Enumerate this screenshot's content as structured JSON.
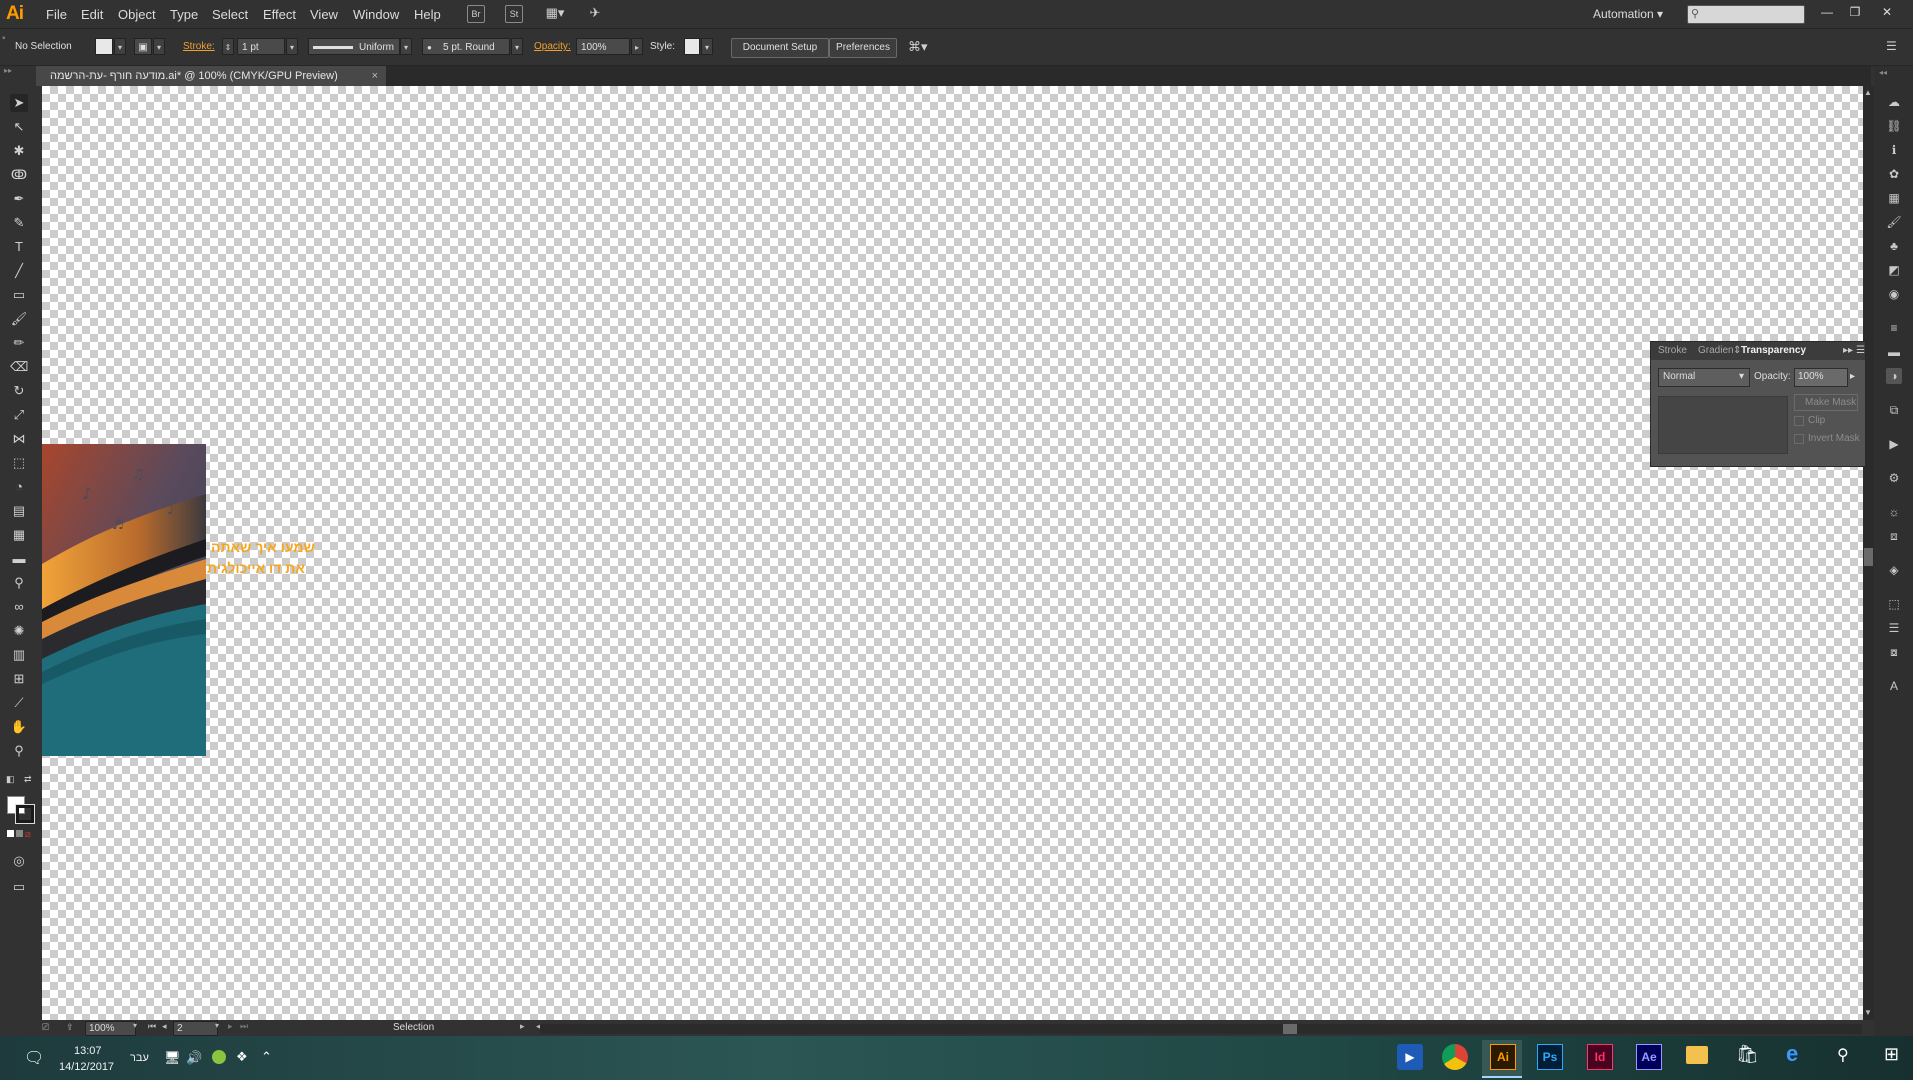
{
  "app": {
    "logo": "Ai"
  },
  "menu": {
    "items": [
      "File",
      "Edit",
      "Object",
      "Type",
      "Select",
      "Effect",
      "View",
      "Window",
      "Help"
    ],
    "bridge_label": "Br",
    "stock_label": "St",
    "workspace": "Automation ▾"
  },
  "control": {
    "selection": "No Selection",
    "stroke_label": "Stroke:",
    "stroke_weight": "1 pt",
    "profile": "Uniform",
    "brush": "5 pt. Round",
    "opacity_label": "Opacity:",
    "opacity_value": "100%",
    "style_label": "Style:",
    "document_setup": "Document Setup",
    "preferences": "Preferences"
  },
  "document": {
    "tab_title": "מודעה חורף -עת-הרשמה.ai* @ 100% (CMYK/GPU Preview)",
    "close_glyph": "×",
    "artwork_text_line1": "שמעו איך שאתה",
    "artwork_text_line2": "את דו אייכולגית"
  },
  "transparency_panel": {
    "tabs": [
      "Stroke",
      "Gradien",
      "Transparency"
    ],
    "blend_mode": "Normal",
    "opacity_label": "Opacity:",
    "opacity_value": "100%",
    "make_mask": "Make Mask",
    "clip": "Clip",
    "invert_mask": "Invert Mask"
  },
  "status": {
    "zoom": "100%",
    "artboard": "2",
    "tool": "Selection"
  },
  "taskbar": {
    "time": "13:07",
    "date": "14/12/2017",
    "language": "עבר",
    "apps": [
      "Ai",
      "Ps",
      "Id",
      "Ae"
    ]
  },
  "colors": {
    "accent": "#ff9a00",
    "artwork_text": "#f7a71f",
    "artwork_teal": "#1f6d7a"
  }
}
